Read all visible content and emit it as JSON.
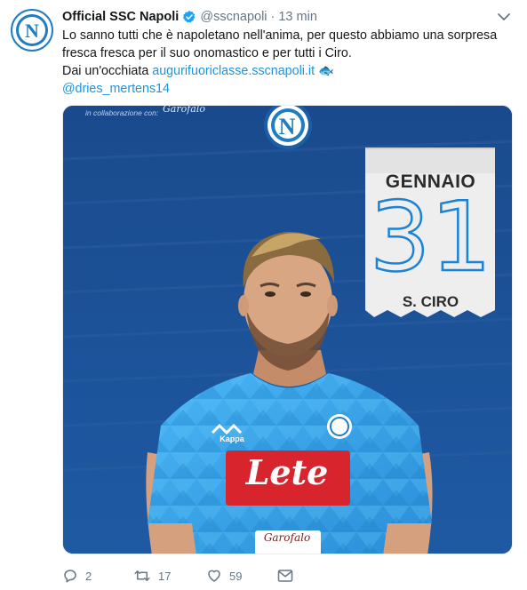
{
  "tweet": {
    "display_name": "Official SSC Napoli",
    "handle": "@sscnapoli",
    "separator": "·",
    "time": "13 min",
    "text_line1": "Lo sanno tutti che è napoletano nell'anima, per questo abbiamo una sorpresa",
    "text_line2": "fresca fresca per il suo onomastico e per tutti i Ciro.",
    "text_line3_prefix": "Dai un'occhiata ",
    "link": "augurifuoriclasse.sscnapoli.it",
    "link_emoji": "🐟",
    "mention": "@dries_mertens14",
    "avatar_letter": "N"
  },
  "media": {
    "collab_text": "in collaborazione con:",
    "collab_brand": "Garofalo",
    "badge_letter": "N",
    "calendar_month": "GENNAIO",
    "calendar_day": "31",
    "calendar_saint": "S. CIRO",
    "jersey_sponsor": "Lete",
    "jersey_brand": "Kappa",
    "shorts_brand": "Garofalo"
  },
  "actions": {
    "reply_count": "2",
    "retweet_count": "17",
    "like_count": "59"
  },
  "colors": {
    "link": "#1b95e0",
    "muted": "#657786",
    "verified": "#1da1f2",
    "background_blue": "#1d4f92",
    "jersey_blue": "#40aef0",
    "sponsor_red": "#d8242c"
  },
  "icons": [
    "verified-badge-icon",
    "chevron-down-icon",
    "reply-icon",
    "retweet-icon",
    "like-icon",
    "message-icon",
    "napoli-logo-icon"
  ]
}
